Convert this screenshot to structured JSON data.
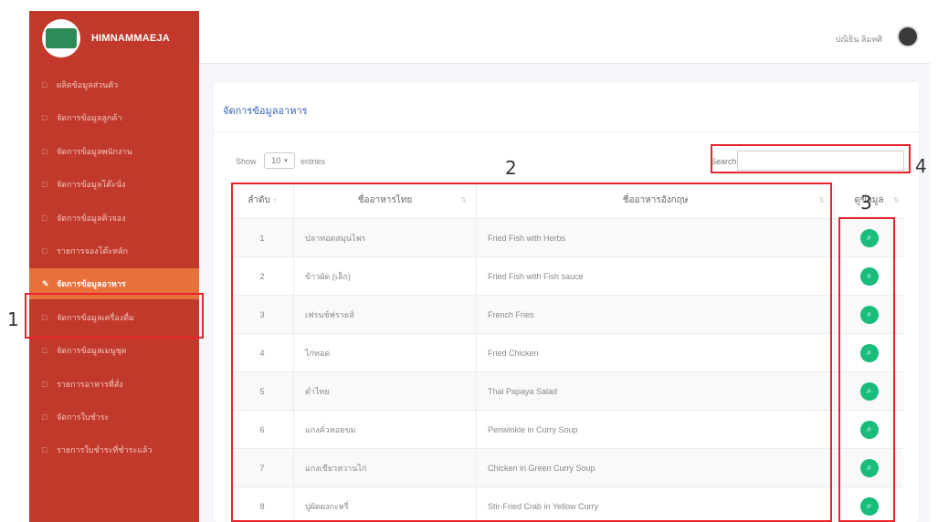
{
  "brand": {
    "name": "HIMNAMMAEJA"
  },
  "sidebar": {
    "items": [
      {
        "label": "ผลิตข้อมูลส่วนตัว",
        "icon": "user-icon"
      },
      {
        "label": "จัดการข้อมูลลูกค้า",
        "icon": "users-icon"
      },
      {
        "label": "จัดการข้อมูลพนักงาน",
        "icon": "id-card-icon"
      },
      {
        "label": "จัดการข้อมูลโต๊ะนั่ง",
        "icon": "table-icon"
      },
      {
        "label": "จัดการข้อมูลคิวจอง",
        "icon": "calendar-icon"
      },
      {
        "label": "รายการจองโต๊ะหลัก",
        "icon": "list-icon"
      },
      {
        "label": "จัดการข้อมูลอาหาร",
        "icon": "food-icon",
        "active": true
      },
      {
        "label": "จัดการข้อมูลเครื่องดื่ม",
        "icon": "drink-icon"
      },
      {
        "label": "จัดการข้อมูลเมนูชุด",
        "icon": "menu-icon"
      },
      {
        "label": "รายการอาหารที่สั่ง",
        "icon": "order-icon"
      },
      {
        "label": "จัดการใบชำระ",
        "icon": "receipt-icon"
      },
      {
        "label": "รายการใบชำระที่ชำระแล้ว",
        "icon": "paid-icon"
      }
    ]
  },
  "header": {
    "user_name": "ปณิธิน ลิมทศิ"
  },
  "card": {
    "title": "จัดการข้อมูลอาหาร"
  },
  "table_controls": {
    "show_label": "Show",
    "page_length": "10",
    "entries_label": "entries",
    "search_label": "Search:",
    "search_value": ""
  },
  "table": {
    "headers": {
      "no": "ลำดับ",
      "thai": "ชื่ออาหารไทย",
      "english": "ชื่ออาหารอังกฤษ",
      "action": "ดูข้อมูล"
    },
    "rows": [
      {
        "no": "1",
        "thai": "ปลาทอดสมุนไพร",
        "english": "Fried Fish with Herbs"
      },
      {
        "no": "2",
        "thai": "ข้าวผัด (เล็ก)",
        "english": "Fried Fish with Fish sauce"
      },
      {
        "no": "3",
        "thai": "เฟรนช์ฟรายส์",
        "english": "French Fries"
      },
      {
        "no": "4",
        "thai": "ไก่ทอด",
        "english": "Fried Chicken"
      },
      {
        "no": "5",
        "thai": "ตำไทย",
        "english": "Thai Papaya Salad"
      },
      {
        "no": "6",
        "thai": "แกงคั่วหอยขม",
        "english": "Periwinkle in Curry Soup"
      },
      {
        "no": "7",
        "thai": "แกงเขียวหวานไก่",
        "english": "Chicken in Green Curry Soup"
      },
      {
        "no": "8",
        "thai": "ปูผัดผงกะหรี่",
        "english": "Stir-Fried Crab in Yellow Curry"
      }
    ]
  },
  "annotations": [
    "1",
    "2",
    "3",
    "4"
  ],
  "colors": {
    "sidebar": "#c0392b",
    "active_item": "#e8703a",
    "view_button": "#1abc7c",
    "annotation": "#e8232b"
  }
}
